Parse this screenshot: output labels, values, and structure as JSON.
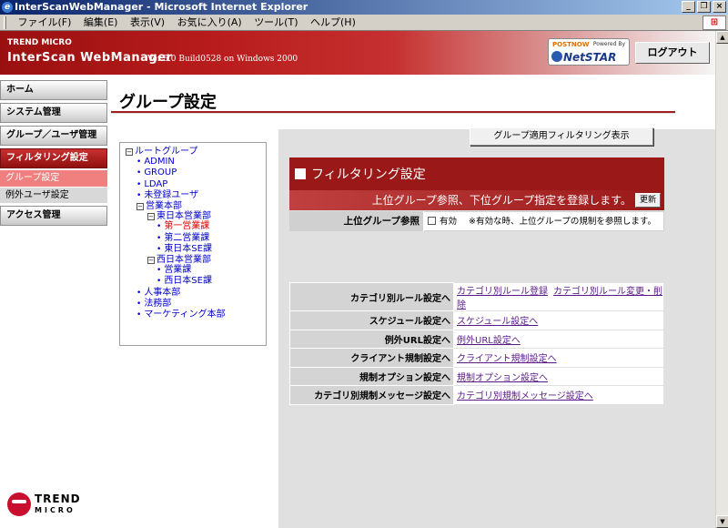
{
  "window": {
    "title": "InterScanWebManager - Microsoft Internet Explorer",
    "menu": [
      "ファイル(F)",
      "編集(E)",
      "表示(V)",
      "お気に入り(A)",
      "ツール(T)",
      "ヘルプ(H)"
    ]
  },
  "header": {
    "brand_small": "TREND MICRO",
    "brand_name": "InterScan WebManager",
    "version": "Ver.5.0 Build0528 on Windows 2000",
    "partner_top": "POSTNOW",
    "partner_powered": "Powered By",
    "partner_name": "NetSTAR",
    "logout_label": "ログアウト"
  },
  "sidebar": {
    "items": [
      {
        "label": "ホーム"
      },
      {
        "label": "システム管理"
      },
      {
        "label": "グループ／ユーザ管理"
      },
      {
        "label": "フィルタリング設定"
      },
      {
        "label": "グループ設定"
      },
      {
        "label": "例外ユーザ設定"
      },
      {
        "label": "アクセス管理"
      }
    ]
  },
  "footer_logo": {
    "line1": "TREND",
    "line2": "MICRO"
  },
  "page": {
    "title": "グループ設定",
    "group_filter_button": "グループ適用フィルタリング表示"
  },
  "tree": {
    "root": "ルートグループ",
    "n1": "ADMIN",
    "n2": "GROUP",
    "n3": "LDAP",
    "n4": "未登録ユーザ",
    "n5": "営業本部",
    "n6": "東日本営業部",
    "n7": "第一営業課",
    "n8": "第二営業課",
    "n9": "東日本SE課",
    "n10": "西日本営業部",
    "n11": "営業課",
    "n12": "西日本SE課",
    "n13": "人事本部",
    "n14": "法務部",
    "n15": "マーケティング本部"
  },
  "filtering": {
    "header": "フィルタリング設定",
    "subheader": "上位グループ参照、下位グループ指定を登録します。",
    "update_button": "更新",
    "upper_ref_label": "上位グループ参照",
    "checkbox_label": "有効",
    "note": "※有効な時、上位グループの規制を参照します。"
  },
  "settings": {
    "row1": {
      "label": "カテゴリ別ルール設定へ",
      "link1": "カテゴリ別ルール登録",
      "link2": "カテゴリ別ルール変更・削除"
    },
    "row2": {
      "label": "スケジュール設定へ",
      "link1": "スケジュール設定へ"
    },
    "row3": {
      "label": "例外URL設定へ",
      "link1": "例外URL設定へ"
    },
    "row4": {
      "label": "クライアント規制設定へ",
      "link1": "クライアント規制設定へ"
    },
    "row5": {
      "label": "規制オプション設定へ",
      "link1": "規制オプション設定へ"
    },
    "row6": {
      "label": "カテゴリ別規制メッセージ設定へ",
      "link1": "カテゴリ別規制メッセージ設定へ"
    }
  }
}
